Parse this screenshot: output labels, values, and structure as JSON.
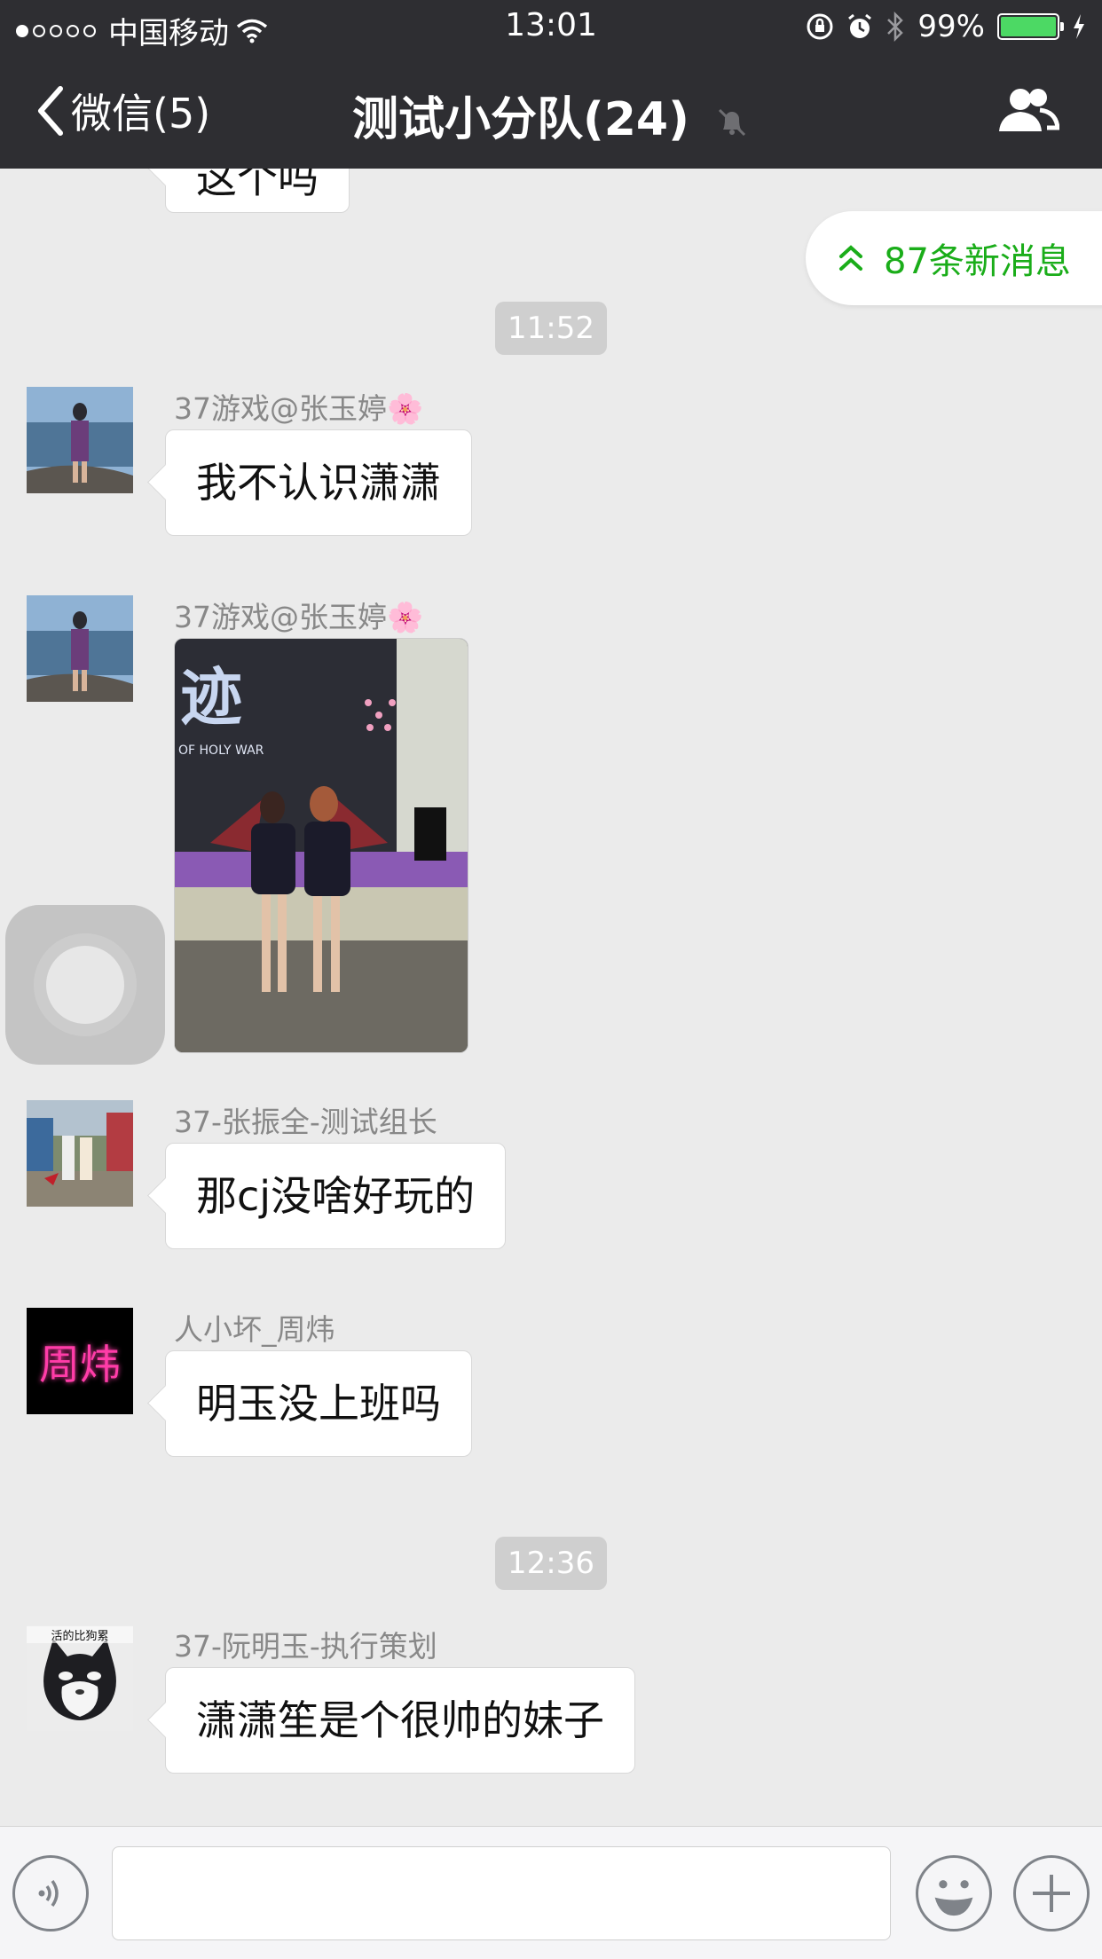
{
  "status_bar": {
    "carrier": "中国移动",
    "time": "13:01",
    "battery_percent": "99%",
    "signal_dots_filled": 1,
    "signal_dots_total": 5,
    "battery_level": 0.99
  },
  "nav": {
    "back_label": "微信(5)",
    "title": "测试小分队(24)"
  },
  "new_messages_banner": "87条新消息",
  "partial_top_message": "这个吗",
  "messages": [
    {
      "type": "timestamp",
      "text": "11:52"
    },
    {
      "type": "text",
      "sender": "37游戏@张玉婷🌸",
      "text": "我不认识潇潇"
    },
    {
      "type": "image",
      "sender": "37游戏@张玉婷🌸"
    },
    {
      "type": "text",
      "sender": "37-张振全-测试组长",
      "text": "那cj没啥好玩的"
    },
    {
      "type": "text",
      "sender": "人小坏_周炜",
      "text": " 明玉没上班吗"
    },
    {
      "type": "timestamp",
      "text": "12:36"
    },
    {
      "type": "text",
      "sender": "37-阮明玉-执行策划",
      "text": "潇潇笙是个很帅的妹子"
    }
  ],
  "avatar_text": {
    "zhouwei": "周炜",
    "cat": "活的比狗累"
  },
  "photo_text": {
    "logo": "迹",
    "sub": "OF HOLY WAR"
  },
  "input": {
    "value": ""
  },
  "colors": {
    "nav_bg": "#2e2e32",
    "chat_bg": "#ebebeb",
    "accent_green": "#1aad19",
    "battery_green": "#4cd964"
  },
  "icons": [
    "wifi-icon",
    "rotation-lock-icon",
    "alarm-icon",
    "bluetooth-icon",
    "battery-icon",
    "charging-icon",
    "back-chevron-icon",
    "mute-bell-icon",
    "group-members-icon",
    "double-chevron-up-icon",
    "voice-icon",
    "emoji-icon",
    "plus-icon"
  ]
}
